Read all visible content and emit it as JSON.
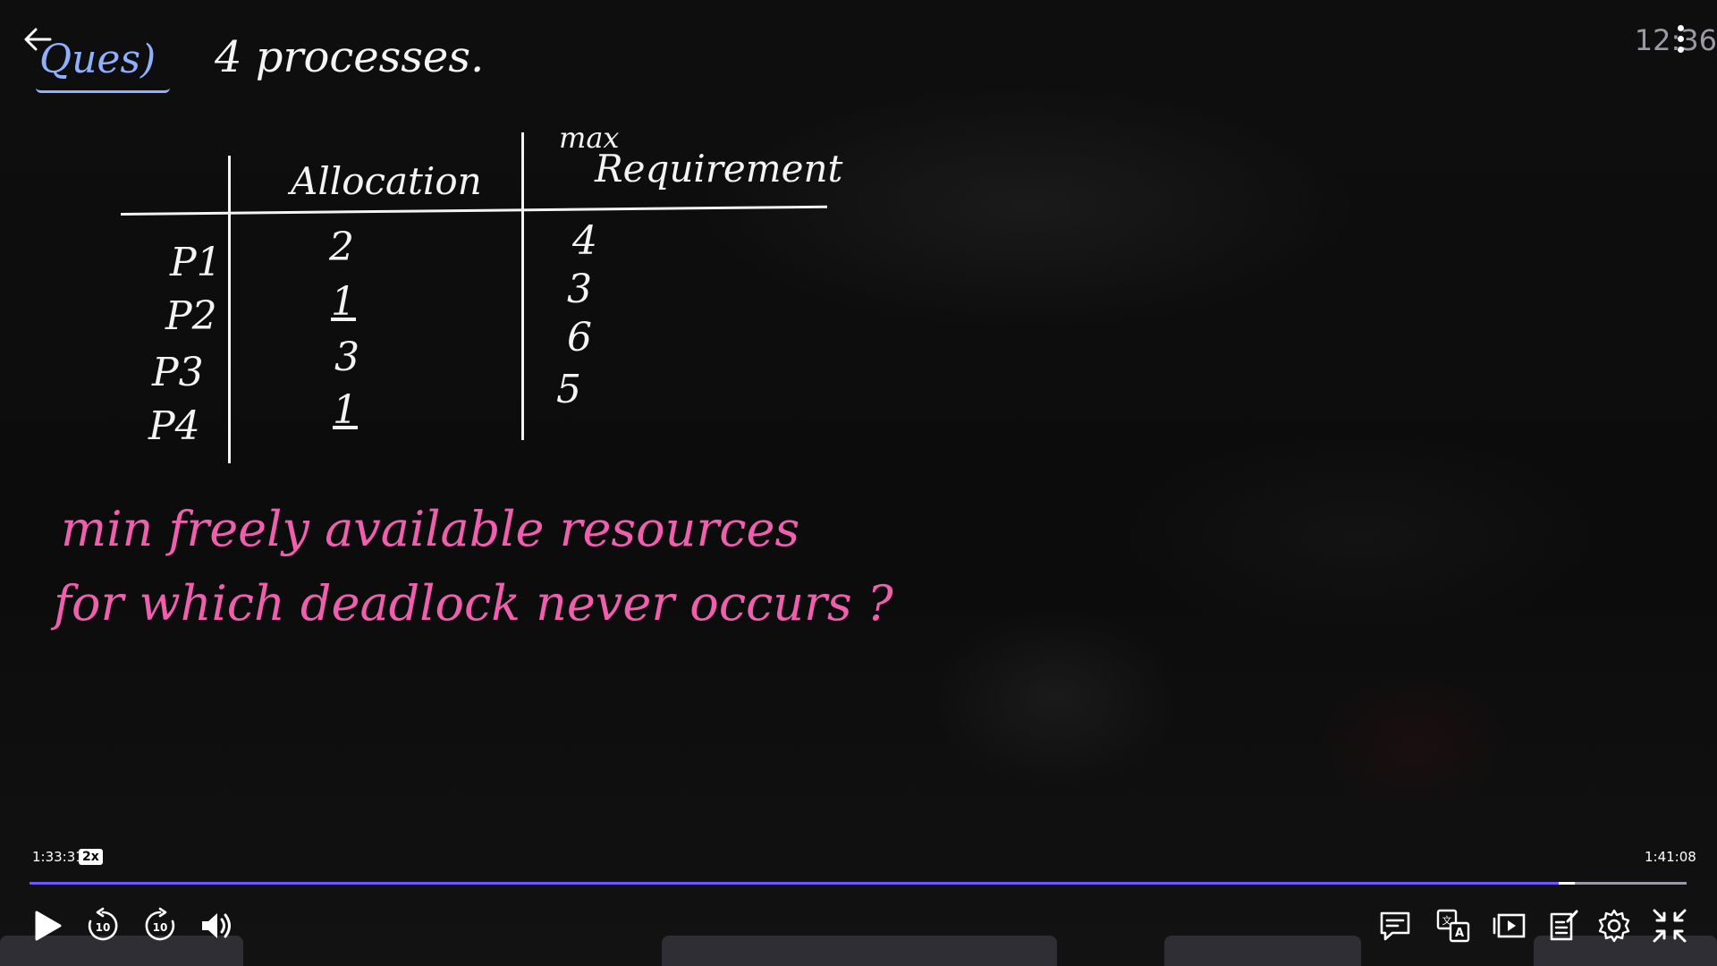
{
  "board": {
    "question_label": "Ques)",
    "question_text": "4 processes.",
    "table": {
      "headers": {
        "allocation": "Allocation",
        "max_line1": "max",
        "max_line2": "Requirement"
      },
      "rows": [
        {
          "process": "P1",
          "allocation": "2",
          "max": "4"
        },
        {
          "process": "P2",
          "allocation": "1",
          "max": "3"
        },
        {
          "process": "P3",
          "allocation": "3",
          "max": "6"
        },
        {
          "process": "P4",
          "allocation": "1",
          "max": "5"
        }
      ]
    },
    "prompt_line1": "min freely available resources",
    "prompt_line2": "for which deadlock never occurs ?"
  },
  "overlay": {
    "clock": "12:36"
  },
  "player": {
    "current_time": "1:33:31",
    "speed": "2x",
    "total_time": "1:41:08",
    "progress_fraction": 0.923,
    "accent_color": "#6b5bff",
    "icons": {
      "back": "back-arrow-icon",
      "play": "play-icon",
      "rewind": "rewind-10-icon",
      "forward": "forward-10-icon",
      "volume": "volume-icon",
      "captions": "captions-icon",
      "translate": "translate-icon",
      "pip": "picture-in-picture-icon",
      "notes": "notes-icon",
      "settings": "gear-icon",
      "exit_fullscreen": "exit-fullscreen-icon"
    }
  }
}
